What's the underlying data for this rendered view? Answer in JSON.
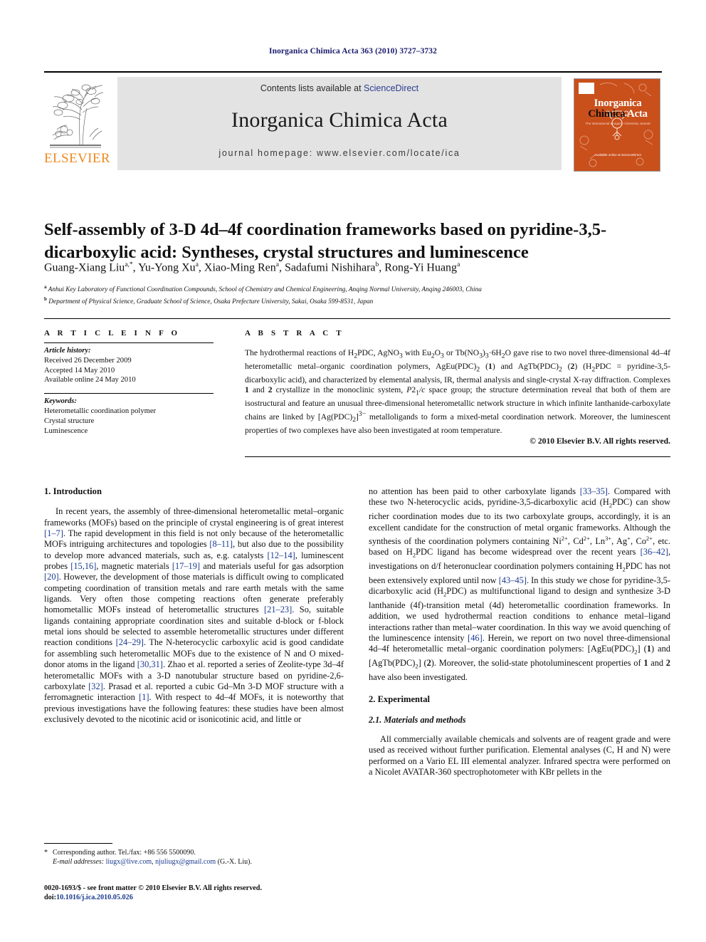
{
  "running_head": "Inorganica Chimica Acta 363 (2010) 3727–3732",
  "masthead": {
    "contents_prefix": "Contents lists available at ",
    "sciencedirect": "ScienceDirect",
    "journal_title": "Inorganica Chimica Acta",
    "homepage": "journal homepage: www.elsevier.com/locate/ica",
    "publisher": "ELSEVIER",
    "cover": {
      "line1": "Inorganica",
      "line2a": "Chimica",
      "line2b": "Acta",
      "subtitle": "The International Inorganic Chemistry Journal",
      "sciencedirect_badge": "Available online at ScienceDirect",
      "bg_color": "#c94f1b"
    },
    "link_color": "#2a3b8f",
    "band_color": "#e3e3e3",
    "elsevier_orange": "#ED8B22"
  },
  "article": {
    "title": "Self-assembly of 3-D 4d–4f coordination frameworks based on pyridine-3,5-dicarboxylic acid: Syntheses, crystal structures and luminescence",
    "authors_html": "Guang-Xiang Liu<sup>a,*</sup>, Yu-Yong Xu<sup>a</sup>, Xiao-Ming Ren<sup>a</sup>, Sadafumi Nishihara<sup>b</sup>, Rong-Yi Huang<sup>a</sup>",
    "affiliation_a": "Anhui Key Laboratory of Functional Coordination Compounds, School of Chemistry and Chemical Engineering, Anqing Normal University, Anqing 246003, China",
    "affiliation_b": "Department of Physical Science, Graduate School of Science, Osaka Prefecture University, Sakai, Osaka 599-8531, Japan"
  },
  "headers": {
    "article_info": "A R T I C L E   I N F O",
    "abstract": "A B S T R A C T"
  },
  "article_info": {
    "history_label": "Article history:",
    "history": [
      "Received 26 December 2009",
      "Accepted 14 May 2010",
      "Available online 24 May 2010"
    ],
    "keywords_label": "Keywords:",
    "keywords": [
      "Heterometallic coordination polymer",
      "Crystal structure",
      "Luminescence"
    ]
  },
  "abstract": {
    "text_html": "The hydrothermal reactions of H<sub>2</sub>PDC, AgNO<sub>3</sub> with Eu<sub>2</sub>O<sub>3</sub> or Tb(NO<sub>3</sub>)<sub>3</sub>·6H<sub>2</sub>O gave rise to two novel three-dimensional 4d–4f heterometallic metal–organic coordination polymers, AgEu(PDC)<sub>2</sub> (<b>1</b>) and AgTb(PDC)<sub>2</sub> (<b>2</b>) (H<sub>2</sub>PDC = pyridine-3,5-dicarboxylic acid), and characterized by elemental analysis, IR, thermal analysis and single-crystal X-ray diffraction. Complexes <b>1</b> and <b>2</b> crystallize in the monoclinic system, <i>P</i>2<sub>1</sub><i>/c</i> space group; the structure determination reveal that both of them are isostructural and feature an unusual three-dimensional heterometallic network structure in which infinite lanthanide-carboxylate chains are linked by [Ag(PDC)<sub>2</sub>]<sup>3−</sup> metalloligands to form a mixed-metal coordination network. Moreover, the luminescent properties of two complexes have also been investigated at room temperature.",
    "copyright": "© 2010 Elsevier B.V. All rights reserved."
  },
  "body": {
    "left": {
      "section_1_heading": "1. Introduction",
      "para_1_html": "In recent years, the assembly of three-dimensional heterometallic metal–organic frameworks (MOFs) based on the principle of crystal engineering is of great interest <span class=\"ref\">[1–7]</span>. The rapid development in this field is not only because of the heterometallic MOFs intriguing architectures and topologies <span class=\"ref\">[8–11]</span>, but also due to the possibility to develop more advanced materials, such as, e.g. catalysts <span class=\"ref\">[12–14]</span>, luminescent probes <span class=\"ref\">[15,16]</span>, magnetic materials <span class=\"ref\">[17–19]</span> and materials useful for gas adsorption <span class=\"ref\">[20]</span>. However, the development of those materials is difficult owing to complicated competing coordination of transition metals and rare earth metals with the same ligands. Very often those competing reactions often generate preferably homometallic MOFs instead of heterometallic structures <span class=\"ref\">[21–23]</span>. So, suitable ligands containing appropriate coordination sites and suitable d-block or f-block metal ions should be selected to assemble heterometallic structures under different reaction conditions <span class=\"ref\">[24–29]</span>. The N-heterocyclic carboxylic acid is good candidate for assembling such heterometallic MOFs due to the existence of N and O mixed-donor atoms in the ligand <span class=\"ref\">[30,31]</span>. Zhao et al. reported a series of Zeolite-type 3d–4f heterometallic MOFs with a 3-D nanotubular structure based on pyridine-2,6-carboxylate <span class=\"ref\">[32]</span>. Prasad et al. reported a cubic Gd–Mn 3-D MOF structure with a ferromagnetic interaction <span class=\"ref\">[1]</span>. With respect to 4d–4f MOFs, it is noteworthy that previous investigations have the following features: these studies have been almost exclusively devoted to the nicotinic acid or isonicotinic acid, and little or"
    },
    "right": {
      "para_1_html": "no attention has been paid to other carboxylate ligands <span class=\"ref\">[33–35]</span>. Compared with these two N-heterocyclic acids, pyridine-3,5-dicarboxylic acid (H<sub>2</sub>PDC) can show richer coordination modes due to its two carboxylate groups, accordingly, it is an excellent candidate for the construction of metal organic frameworks. Although the synthesis of the coordination polymers containing Ni<sup>2+</sup>, Cd<sup>2+</sup>, Ln<sup>3+</sup>, Ag<sup>+</sup>, Co<sup>2+</sup>, etc. based on H<sub>2</sub>PDC ligand has become widespread over the recent years <span class=\"ref\">[36–42]</span>, investigations on d/f heteronuclear coordination polymers containing H<sub>2</sub>PDC has not been extensively explored until now <span class=\"ref\">[43–45]</span>. In this study we chose for pyridine-3,5-dicarboxylic acid (H<sub>2</sub>PDC) as multifunctional ligand to design and synthesize 3-D lanthanide (4f)-transition metal (4d) heterometallic coordination frameworks. In addition, we used hydrothermal reaction conditions to enhance metal–ligand interactions rather than metal–water coordination. In this way we avoid quenching of the luminescence intensity <span class=\"ref\">[46]</span>. Herein, we report on two novel three-dimensional 4d–4f heterometallic metal–organic coordination polymers: [AgEu(PDC)<sub>2</sub>] (<b>1</b>) and [AgTb(PDC)<sub>2</sub>] (<b>2</b>). Moreover, the solid-state photoluminescent properties of <b>1</b> and <b>2</b> have also been investigated.",
      "section_2_heading": "2. Experimental",
      "subsection_21_heading": "2.1. Materials and methods",
      "para_2_html": "All commercially available chemicals and solvents are of reagent grade and were used as received without further purification. Elemental analyses (C, H and N) were performed on a Vario EL III elemental analyzer. Infrared spectra were performed on a Nicolet AVATAR-360 spectrophotometer with KBr pellets in the"
    }
  },
  "footnote": {
    "star": "*",
    "corresponding": "Corresponding author. Tel./fax: +86 556 5500090.",
    "email_label": "E-mail addresses:",
    "email_1": "liugx@live.com",
    "email_sep": ", ",
    "email_2": "njuliugx@gmail.com",
    "email_suffix": " (G.-X. Liu)."
  },
  "footer": {
    "line1": "0020-1693/$ - see front matter © 2010 Elsevier B.V. All rights reserved.",
    "doi_label": "doi:",
    "doi": "10.1016/j.ica.2010.05.026"
  },
  "colors": {
    "link": "#1a3a8f",
    "running_head": "#1a1a6e",
    "accent_orange": "#ED8B22"
  }
}
